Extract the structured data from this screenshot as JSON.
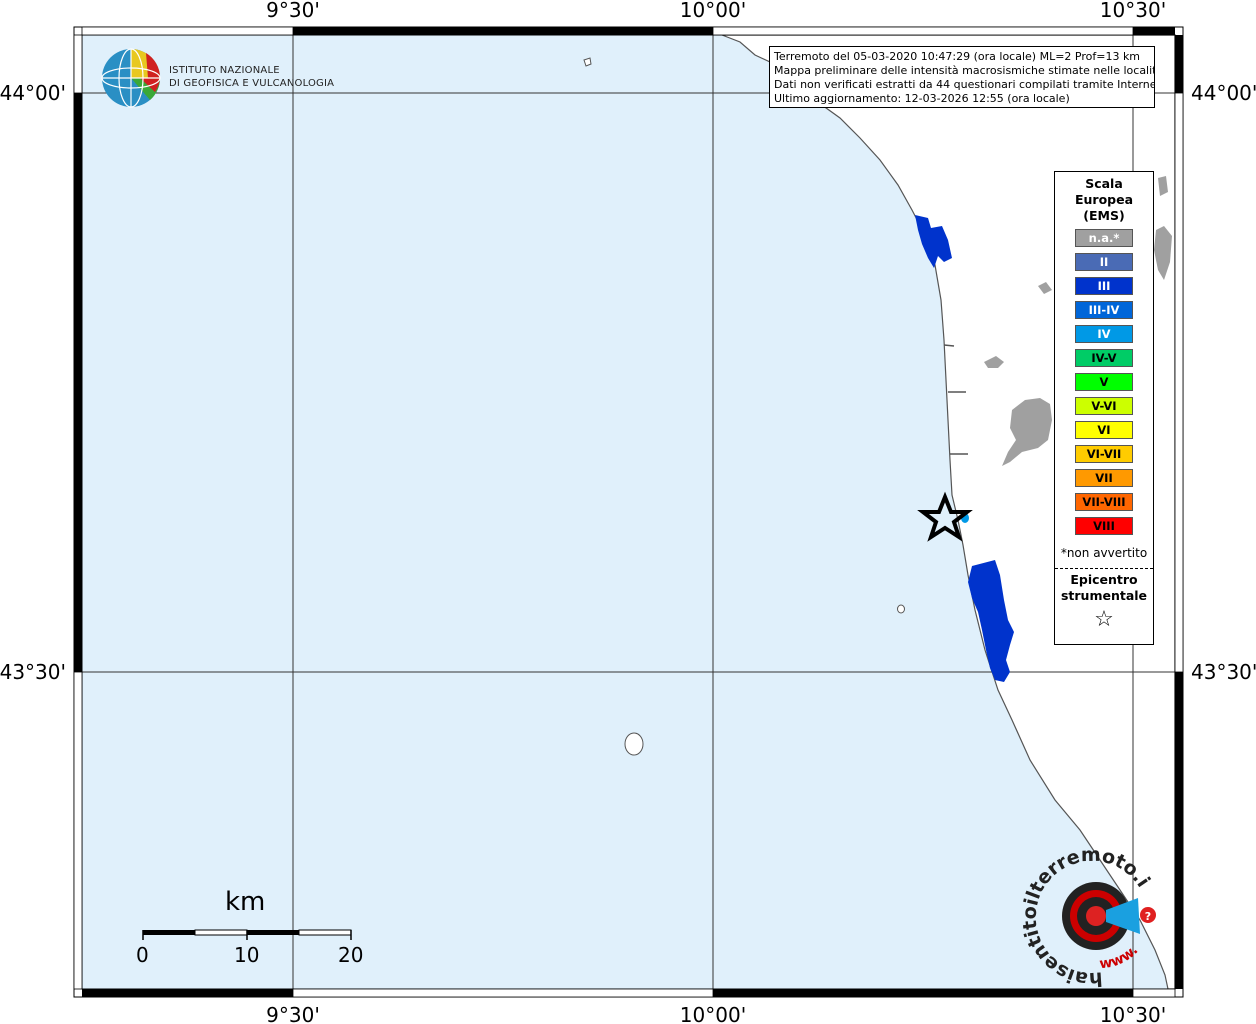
{
  "map": {
    "lon_labels": [
      "9°30'",
      "10°00'",
      "10°30'"
    ],
    "lat_labels": [
      "44°00'",
      "43°30'"
    ],
    "colors": {
      "sea": "#e0f0fb",
      "land": "#ffffff",
      "frame": "#000000",
      "unfelt_gray": "#a0a0a0",
      "ems_iii": "#0033cc",
      "ems_iv": "#0099e6"
    }
  },
  "logo": {
    "text": "ISTITUTO NAZIONALE\nDI GEOFISICA E VULCANOLOGIA"
  },
  "info": {
    "lines": [
      "Terremoto del 05-03-2020 10:47:29 (ora locale) ML=2 Prof=13 km",
      "Mappa preliminare delle intensità macrosismiche stimate nelle località",
      "Dati non verificati estratti da 44 questionari compilati tramite Internet.",
      "Ultimo aggiornamento: 12-03-2026 12:55 (ora locale)"
    ]
  },
  "legend": {
    "title": "Scala\nEuropea\n(EMS)",
    "items": [
      {
        "label": "n.a.*",
        "color": "#a0a0a0",
        "text_color": "#ffffff"
      },
      {
        "label": "II",
        "color": "#4a6bb5",
        "text_color": "#ffffff"
      },
      {
        "label": "III",
        "color": "#0033cc",
        "text_color": "#ffffff"
      },
      {
        "label": "III-IV",
        "color": "#0066d9",
        "text_color": "#ffffff"
      },
      {
        "label": "IV",
        "color": "#0099e6",
        "text_color": "#ffffff"
      },
      {
        "label": "IV-V",
        "color": "#00cc66",
        "text_color": "#000000"
      },
      {
        "label": "V",
        "color": "#00ff00",
        "text_color": "#000000"
      },
      {
        "label": "V-VI",
        "color": "#ccff00",
        "text_color": "#000000"
      },
      {
        "label": "VI",
        "color": "#ffff00",
        "text_color": "#000000"
      },
      {
        "label": "VI-VII",
        "color": "#ffcc00",
        "text_color": "#000000"
      },
      {
        "label": "VII",
        "color": "#ff9900",
        "text_color": "#000000"
      },
      {
        "label": "VII-VIII",
        "color": "#ff6600",
        "text_color": "#000000"
      },
      {
        "label": "VIII",
        "color": "#ff0000",
        "text_color": "#000000"
      }
    ],
    "footnote": "*non avvertito",
    "epicenter_title": "Epicentro\nstrumentale",
    "epicenter_symbol": "☆"
  },
  "scale_bar": {
    "title": "km",
    "labels": [
      "0",
      "10",
      "20"
    ]
  },
  "watermark": {
    "text": "haisentitoilterremoto.it",
    "url_text": "www."
  }
}
